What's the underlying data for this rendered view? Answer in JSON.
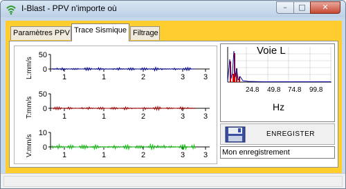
{
  "window": {
    "title": "I-Blast - PPV n'importe où",
    "controls": {
      "minimize": "–",
      "maximize": "□",
      "close": "✕"
    },
    "title_icon": "wifi-icon"
  },
  "tabs": [
    {
      "label": "Paramètres PPV",
      "selected": false
    },
    {
      "label": "Trace Sismique",
      "selected": true
    },
    {
      "label": "Filtrage",
      "selected": false
    }
  ],
  "traces": [
    {
      "ylabel": "L:mm/s",
      "yticks": [
        "50",
        "0"
      ],
      "xticks": [
        "1",
        "1",
        "2",
        "3",
        "3"
      ],
      "color": "#0a0a9e"
    },
    {
      "ylabel": "T:mm/s",
      "yticks": [
        "50",
        "0"
      ],
      "xticks": [
        "1",
        "1",
        "2",
        "3",
        "3"
      ],
      "color": "#b20f0f"
    },
    {
      "ylabel": "V:mm/s",
      "yticks": [
        "10",
        "0"
      ],
      "xticks": [
        "1",
        "1",
        "2",
        "3",
        "3"
      ],
      "color": "#1fcc1f"
    }
  ],
  "spectrum": {
    "title": "Voie L",
    "xlabel": "Hz",
    "xticks": [
      "24.8",
      "49.8",
      "74.8",
      "99.8"
    ],
    "bar_color": "#d40000",
    "line_color": "#0a0a9e"
  },
  "save_button": {
    "label": "ENREGISTER",
    "icon": "floppy-disk-icon"
  },
  "recording_name": {
    "value": "Mon enregistrement"
  },
  "colors": {
    "tab_strip_bg": "#ffce2e",
    "window_frame": "#c7d8ea"
  }
}
